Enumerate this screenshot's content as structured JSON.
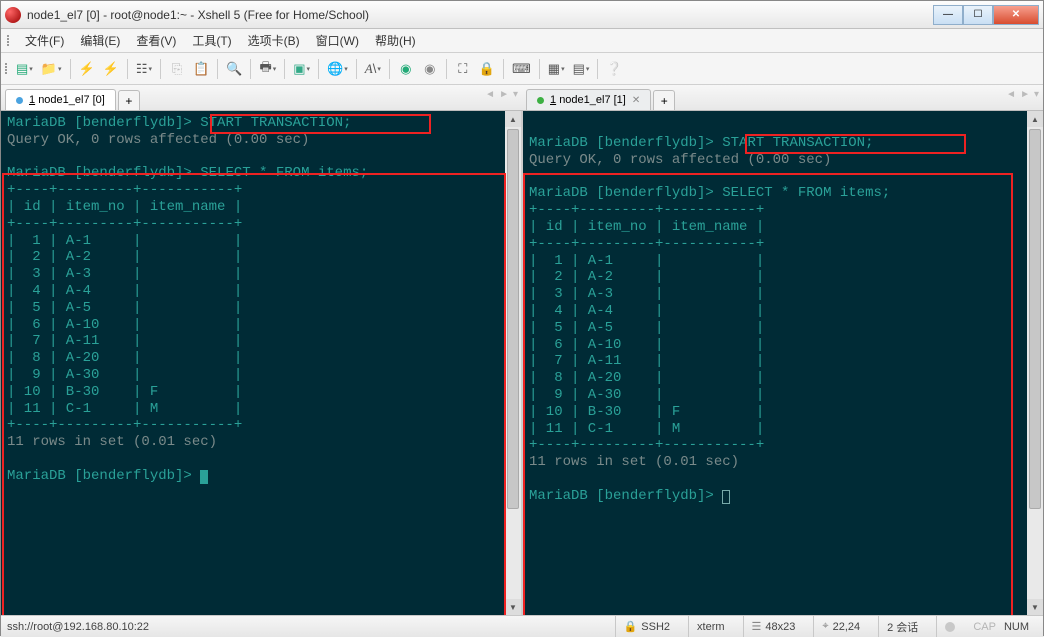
{
  "window": {
    "title": "node1_el7 [0] - root@node1:~ - Xshell 5 (Free for Home/School)"
  },
  "menu": {
    "file": "文件(F)",
    "edit": "编辑(E)",
    "view": "查看(V)",
    "tool": "工具(T)",
    "tabs": "选项卡(B)",
    "window": "窗口(W)",
    "help": "帮助(H)"
  },
  "tabs": {
    "left": {
      "prefix": "1",
      "label": "node1_el7 [0]"
    },
    "right": {
      "prefix": "1",
      "label": "node1_el7 [1]"
    },
    "add": "+"
  },
  "term": {
    "left": {
      "prompt": "MariaDB [benderflydb]>",
      "start_tx": "START TRANSACTION;",
      "ok": "Query OK, 0 rows affected (0.00 sec)",
      "select": "SELECT * FROM items;",
      "border": "+----+---------+-----------+",
      "header": "| id | item_no | item_name |",
      "rows": [
        "|  1 | A-1     |           |",
        "|  2 | A-2     |           |",
        "|  3 | A-3     |           |",
        "|  4 | A-4     |           |",
        "|  5 | A-5     |           |",
        "|  6 | A-10    |           |",
        "|  7 | A-11    |           |",
        "|  8 | A-20    |           |",
        "|  9 | A-30    |           |",
        "| 10 | B-30    | F         |",
        "| 11 | C-1     | M         |"
      ],
      "footer": "11 rows in set (0.01 sec)"
    },
    "right": {
      "prompt": "MariaDB [benderflydb]>",
      "start_tx": "START TRANSACTION;",
      "ok": "Query OK, 0 rows affected (0.00 sec)",
      "select": "SELECT * FROM items;",
      "border": "+----+---------+-----------+",
      "header": "| id | item_no | item_name |",
      "rows": [
        "|  1 | A-1     |           |",
        "|  2 | A-2     |           |",
        "|  3 | A-3     |           |",
        "|  4 | A-4     |           |",
        "|  5 | A-5     |           |",
        "|  6 | A-10    |           |",
        "|  7 | A-11    |           |",
        "|  8 | A-20    |           |",
        "|  9 | A-30    |           |",
        "| 10 | B-30    | F         |",
        "| 11 | C-1     | M         |"
      ],
      "footer": "11 rows in set (0.01 sec)"
    }
  },
  "status": {
    "conn": "ssh://root@192.168.80.10:22",
    "ssh": "SSH2",
    "term": "xterm",
    "size": "48x23",
    "pos": "22,24",
    "sess": "2 会话",
    "cap": "CAP",
    "num": "NUM"
  }
}
